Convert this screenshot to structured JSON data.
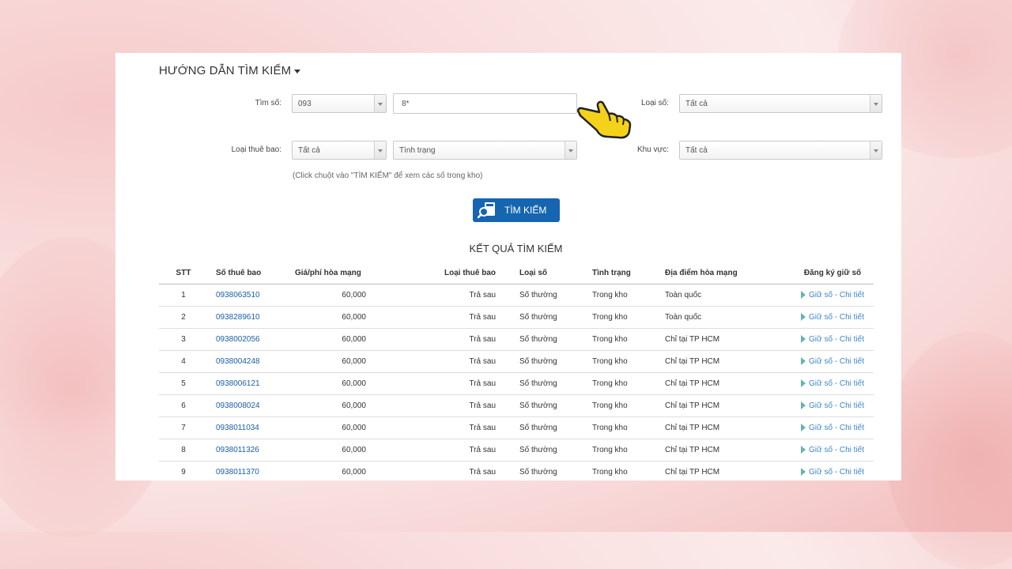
{
  "guide": {
    "title": "HƯỚNG DẪN TÌM KIẾM"
  },
  "form": {
    "tim_so_label": "Tìm số:",
    "prefix_value": "093",
    "pattern_value": "8*",
    "loai_so_label": "Loại số:",
    "loai_so_value": "Tất cả",
    "loai_thue_bao_label": "Loại thuê bao:",
    "loai_thue_bao_value": "Tất cả",
    "tinh_trang_value": "Tình trạng",
    "khu_vuc_label": "Khu vực:",
    "khu_vuc_value": "Tất cả",
    "hint": "(Click chuột vào \"TÌM KIẾM\" để xem các số trong kho)",
    "search_button": "TÌM KIẾM"
  },
  "results": {
    "title": "KẾT QUẢ TÌM KIẾM",
    "columns": [
      "STT",
      "Số thuê bao",
      "Giá/phí hòa mạng",
      "Loại thuê bao",
      "Loại số",
      "Tình trạng",
      "Địa điểm hòa mạng",
      "Đăng ký giữ số"
    ],
    "rows": [
      [
        "1",
        "0938063510",
        "60,000",
        "Trả sau",
        "Số thường",
        "Trong kho",
        "Toàn quốc",
        "Giữ số - Chi tiết"
      ],
      [
        "2",
        "0938289610",
        "60,000",
        "Trả sau",
        "Số thường",
        "Trong kho",
        "Toàn quốc",
        "Giữ số - Chi tiết"
      ],
      [
        "3",
        "0938002056",
        "60,000",
        "Trả sau",
        "Số thường",
        "Trong kho",
        "Chỉ tại TP HCM",
        "Giữ số - Chi tiết"
      ],
      [
        "4",
        "0938004248",
        "60,000",
        "Trả sau",
        "Số thường",
        "Trong kho",
        "Chỉ tại TP HCM",
        "Giữ số - Chi tiết"
      ],
      [
        "5",
        "0938006121",
        "60,000",
        "Trả sau",
        "Số thường",
        "Trong kho",
        "Chỉ tại TP HCM",
        "Giữ số - Chi tiết"
      ],
      [
        "6",
        "0938008024",
        "60,000",
        "Trả sau",
        "Số thường",
        "Trong kho",
        "Chỉ tại TP HCM",
        "Giữ số - Chi tiết"
      ],
      [
        "7",
        "0938011034",
        "60,000",
        "Trả sau",
        "Số thường",
        "Trong kho",
        "Chỉ tại TP HCM",
        "Giữ số - Chi tiết"
      ],
      [
        "8",
        "0938011326",
        "60,000",
        "Trả sau",
        "Số thường",
        "Trong kho",
        "Chỉ tại TP HCM",
        "Giữ số - Chi tiết"
      ],
      [
        "9",
        "0938011370",
        "60,000",
        "Trả sau",
        "Số thường",
        "Trong kho",
        "Chỉ tại TP HCM",
        "Giữ số - Chi tiết"
      ]
    ]
  },
  "colors": {
    "button_blue": "#1565b0",
    "link_blue": "#1a5fa6",
    "hand_yellow": "#f5d21a"
  },
  "icons": {
    "pointer": "pointing-hand-icon",
    "search": "search-magnifier-icon"
  }
}
